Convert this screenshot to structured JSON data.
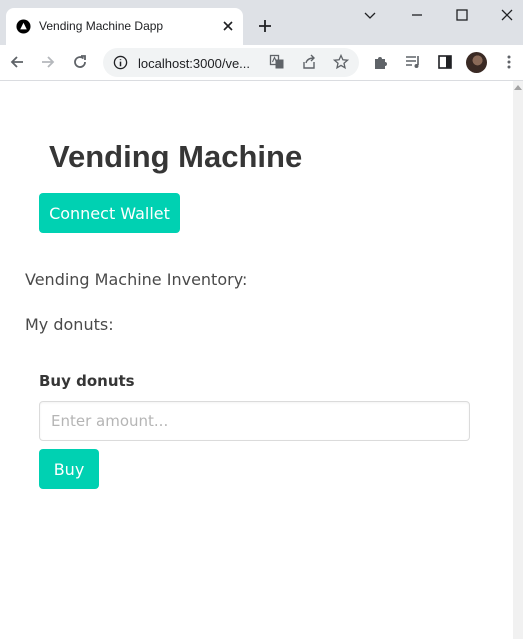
{
  "browser": {
    "tab_title": "Vending Machine Dapp",
    "url": "localhost:3000/ve...",
    "icons": [
      "app-favicon",
      "close-icon",
      "plus-icon",
      "minimize-icon",
      "maximize-icon",
      "window-close-icon",
      "back-icon",
      "forward-icon",
      "reload-icon",
      "info-icon",
      "translate-icon",
      "share-icon",
      "star-icon",
      "extensions-icon",
      "reading-list-icon",
      "side-panel-icon",
      "avatar",
      "kebab-menu-icon"
    ]
  },
  "page": {
    "title": "Vending Machine",
    "connect_button": "Connect Wallet",
    "inventory_label": "Vending Machine Inventory:",
    "my_donuts_label": "My donuts:",
    "buy_section": {
      "label": "Buy donuts",
      "input_placeholder": "Enter amount...",
      "input_value": "",
      "buy_button": "Buy"
    }
  },
  "colors": {
    "accent": "#00d1b2",
    "title_text": "#363636",
    "body_text": "#4a4a4a",
    "tabstrip": "#dee1e6"
  }
}
